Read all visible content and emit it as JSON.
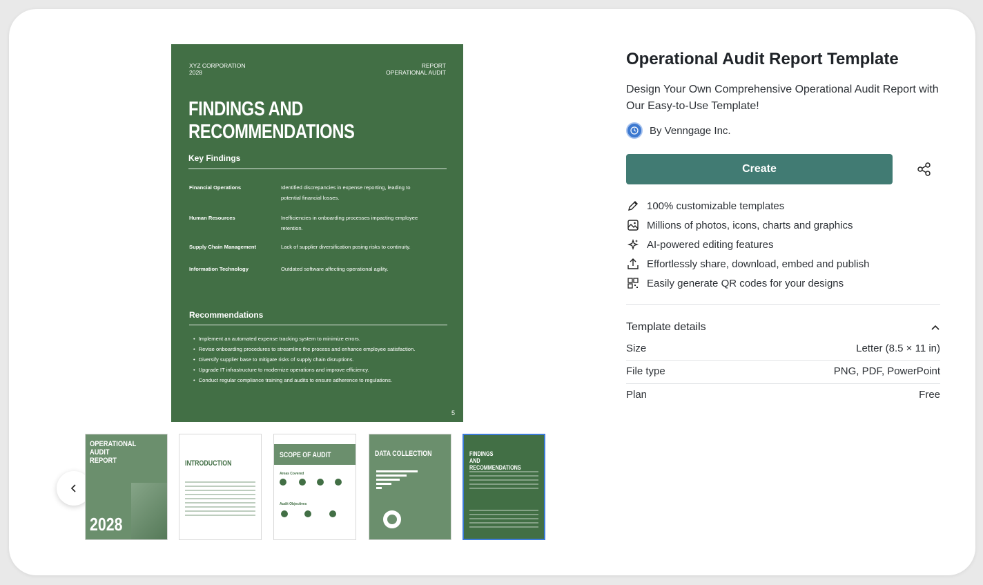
{
  "preview": {
    "corp": "XYZ CORPORATION",
    "year": "2028",
    "report": "REPORT",
    "report_sub": "OPERATIONAL AUDIT",
    "title_line1": "FINDINGS AND",
    "title_line2": "RECOMMENDATIONS",
    "key_findings_heading": "Key Findings",
    "findings": [
      {
        "area": "Financial Operations",
        "text": "Identified discrepancies in expense reporting, leading to potential financial losses."
      },
      {
        "area": "Human Resources",
        "text": "Inefficiencies in onboarding processes impacting employee retention."
      },
      {
        "area": "Supply Chain Management",
        "text": "Lack of supplier diversification posing risks to continuity."
      },
      {
        "area": "Information Technology",
        "text": "Outdated software affecting operational agility."
      }
    ],
    "recommendations_heading": "Recommendations",
    "recommendations": [
      "Implement an automated expense tracking system to minimize errors.",
      "Revise onboarding procedures to streamline the process and enhance employee satisfaction.",
      "Diversify supplier base to mitigate risks of supply chain disruptions.",
      "Upgrade IT infrastructure to modernize operations and improve efficiency.",
      "Conduct regular compliance training and audits to ensure adherence to regulations."
    ],
    "page_number": "5"
  },
  "thumbnails": [
    {
      "title": "OPERATIONAL AUDIT REPORT",
      "year": "2028"
    },
    {
      "title": "INTRODUCTION"
    },
    {
      "title": "SCOPE OF AUDIT",
      "sub1": "Areas Covered",
      "sub2": "Audit Objectives"
    },
    {
      "title": "DATA COLLECTION"
    },
    {
      "title": "FINDINGS AND RECOMMENDATIONS",
      "selected": true
    }
  ],
  "info": {
    "title": "Operational Audit Report Template",
    "subtitle": "Design Your Own Comprehensive Operational Audit Report with Our Easy-to-Use Template!",
    "author": "By Venngage Inc.",
    "create_label": "Create",
    "features": [
      {
        "icon": "pencil-icon",
        "label": "100% customizable templates"
      },
      {
        "icon": "image-icon",
        "label": "Millions of photos, icons, charts and graphics"
      },
      {
        "icon": "sparkle-icon",
        "label": "AI-powered editing features"
      },
      {
        "icon": "upload-icon",
        "label": "Effortlessly share, download, embed and publish"
      },
      {
        "icon": "qr-code-icon",
        "label": "Easily generate QR codes for your designs"
      }
    ],
    "details_heading": "Template details",
    "details": [
      {
        "label": "Size",
        "value": "Letter (8.5 × 11 in)"
      },
      {
        "label": "File type",
        "value": "PNG, PDF, PowerPoint"
      },
      {
        "label": "Plan",
        "value": "Free"
      }
    ]
  },
  "colors": {
    "accent": "#417b73",
    "page_green": "#426f45",
    "selected_border": "#3c7bd8"
  }
}
